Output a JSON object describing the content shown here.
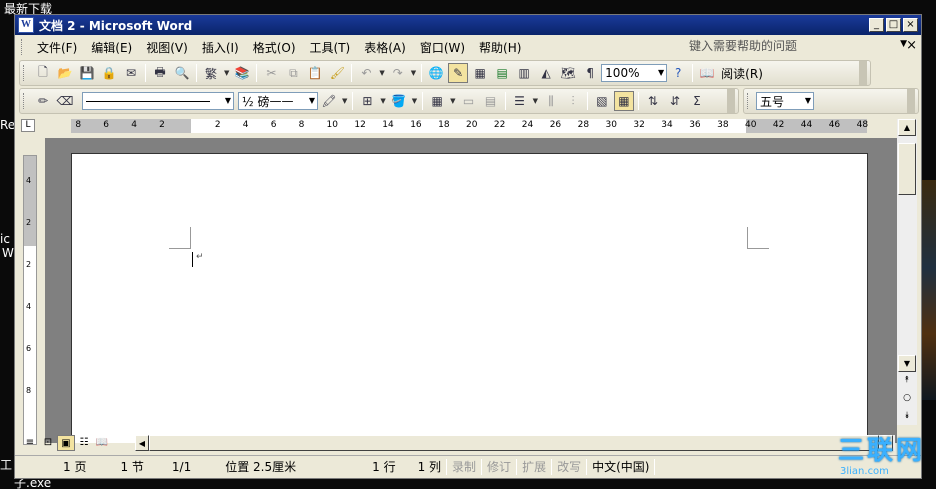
{
  "desktop": {
    "top_label": "最新下载",
    "edge_labels": [
      "Re",
      "ic",
      "W",
      "工"
    ],
    "bottom_label": "子.exe"
  },
  "window": {
    "title": "文档 2 - Microsoft Word",
    "controls": [
      "_",
      "□",
      "×"
    ]
  },
  "menu": {
    "items": [
      "文件(F)",
      "编辑(E)",
      "视图(V)",
      "插入(I)",
      "格式(O)",
      "工具(T)",
      "表格(A)",
      "窗口(W)",
      "帮助(H)"
    ],
    "help_placeholder": "键入需要帮助的问题",
    "close_doc": "×"
  },
  "toolbar_standard": {
    "zoom": "100%",
    "read_label": "阅读(R)",
    "trad_label": "繁"
  },
  "toolbar_tables": {
    "line_weight_label": "½ 磅",
    "line_style": "——",
    "sum_symbol": "Σ"
  },
  "toolbar_format": {
    "font_size": "五号"
  },
  "ruler": {
    "corner": "L",
    "h_numbers": [
      "8",
      "6",
      "4",
      "2",
      "2",
      "4",
      "6",
      "8",
      "10",
      "12",
      "14",
      "16",
      "18",
      "20",
      "22",
      "24",
      "26",
      "28",
      "30",
      "32",
      "34",
      "36",
      "38",
      "40",
      "42",
      "44",
      "46",
      "48"
    ],
    "v_numbers": [
      "4",
      "2",
      "2",
      "4",
      "6",
      "8"
    ]
  },
  "statusbar": {
    "page": "1 页",
    "section": "1 节",
    "page_of": "1/1",
    "position": "位置 2.5厘米",
    "line": "1 行",
    "column": "1 列",
    "rec": "录制",
    "trk": "修订",
    "ext": "扩展",
    "ovr": "改写",
    "language": "中文(中国)"
  },
  "watermark": {
    "logo": "三联网",
    "url": "3lian.com"
  }
}
